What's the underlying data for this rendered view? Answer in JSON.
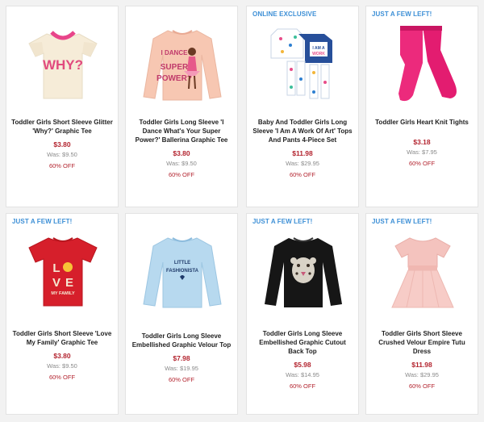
{
  "products": [
    {
      "badge": "",
      "title": "Toddler Girls Short Sleeve Glitter 'Why?' Graphic Tee",
      "price": "$3.80",
      "was": "Was: $9.50",
      "off": "60% OFF",
      "image": "pink-why-tee"
    },
    {
      "badge": "",
      "title": "Toddler Girls Long Sleeve 'I Dance What's Your Super Power?' Ballerina Graphic Tee",
      "price": "$3.80",
      "was": "Was: $9.50",
      "off": "60% OFF",
      "image": "peach-ballerina-tee"
    },
    {
      "badge": "ONLINE EXCLUSIVE",
      "title": "Baby And Toddler Girls Long Sleeve 'I Am A Work Of Art' Tops And Pants 4-Piece Set",
      "price": "$11.98",
      "was": "Was: $29.95",
      "off": "60% OFF",
      "image": "pajama-set"
    },
    {
      "badge": "JUST A FEW LEFT!",
      "title": "Toddler Girls Heart Knit Tights",
      "price": "$3.18",
      "was": "Was: $7.95",
      "off": "60% OFF",
      "image": "pink-tights"
    },
    {
      "badge": "JUST A FEW LEFT!",
      "title": "Toddler Girls Short Sleeve 'Love My Family' Graphic Tee",
      "price": "$3.80",
      "was": "Was: $9.50",
      "off": "60% OFF",
      "image": "red-love-tee"
    },
    {
      "badge": "",
      "title": "Toddler Girls Long Sleeve Embellished Graphic Velour Top",
      "price": "$7.98",
      "was": "Was: $19.95",
      "off": "60% OFF",
      "image": "blue-velour-top"
    },
    {
      "badge": "JUST A FEW LEFT!",
      "title": "Toddler Girls Long Sleeve Embellished Graphic Cutout Back Top",
      "price": "$5.98",
      "was": "Was: $14.95",
      "off": "60% OFF",
      "image": "black-leopard-top"
    },
    {
      "badge": "JUST A FEW LEFT!",
      "title": "Toddler Girls Short Sleeve Crushed Velour Empire Tutu Dress",
      "price": "$11.98",
      "was": "Was: $29.95",
      "off": "60% OFF",
      "image": "pink-tutu-dress"
    }
  ]
}
